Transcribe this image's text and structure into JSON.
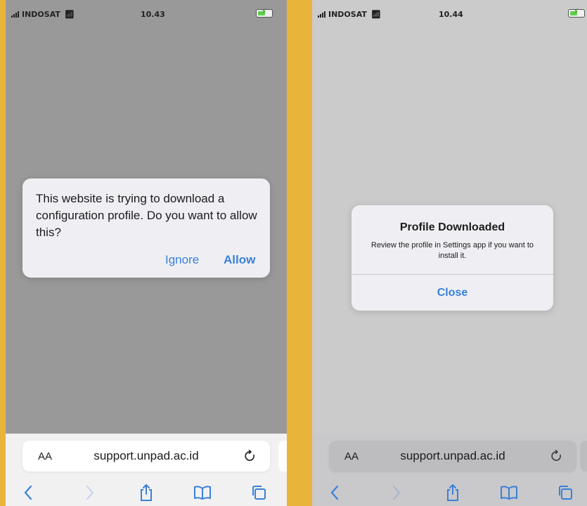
{
  "left_phone": {
    "status_bar": {
      "carrier": "INDOSAT",
      "time": "10.43"
    },
    "dialog": {
      "message": "This website is trying to download a configuration profile. Do you want to allow this?",
      "ignore_label": "Ignore",
      "allow_label": "Allow"
    },
    "address_bar": {
      "aa_label": "AA",
      "url": "support.unpad.ac.id"
    }
  },
  "right_phone": {
    "status_bar": {
      "carrier": "INDOSAT",
      "time": "10.44"
    },
    "dialog": {
      "title": "Profile Downloaded",
      "message": "Review the profile in Settings app if you want to install it.",
      "close_label": "Close"
    },
    "address_bar": {
      "aa_label": "AA",
      "url": "support.unpad.ac.id"
    }
  },
  "icons": [
    "signal-icon",
    "wifi-icon",
    "battery-icon",
    "reload-icon",
    "back-icon",
    "forward-icon",
    "share-icon",
    "bookmarks-icon",
    "tabs-icon"
  ],
  "colors": {
    "background": "#e8b53a",
    "link_blue": "#3a80d8",
    "dimmed_page_left": "#999999",
    "dimmed_page_right": "#cbcbcb"
  }
}
